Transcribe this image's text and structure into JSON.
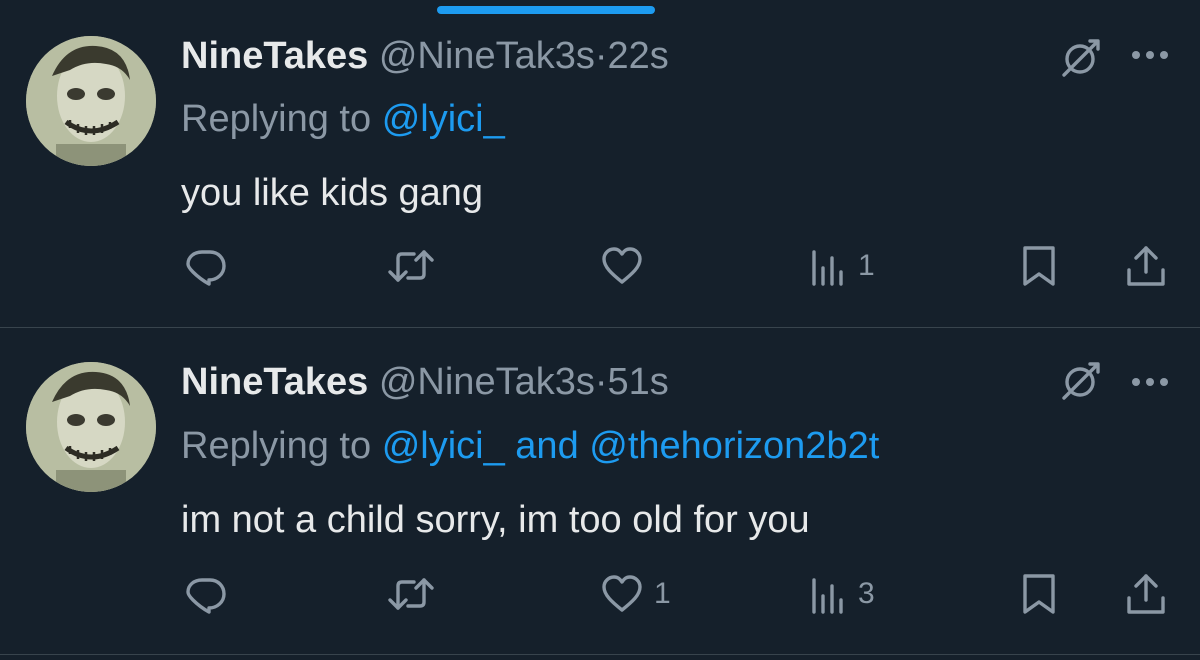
{
  "tweets": [
    {
      "display_name": "NineTakes",
      "handle": "@NineTak3s",
      "separator": "·",
      "time": "22s",
      "replying_prefix": "Replying to",
      "replying_to": "@lyici_",
      "replying_and": "",
      "replying_to_2": "",
      "text": "you like kids gang",
      "reply_count": "",
      "retweet_count": "",
      "like_count": "",
      "view_count": "1"
    },
    {
      "display_name": "NineTakes",
      "handle": "@NineTak3s",
      "separator": "·",
      "time": "51s",
      "replying_prefix": "Replying to",
      "replying_to": "@lyici_",
      "replying_and": "and",
      "replying_to_2": "@thehorizon2b2t",
      "text": "im not a child sorry, im too old for you",
      "reply_count": "",
      "retweet_count": "",
      "like_count": "1",
      "view_count": "3"
    }
  ],
  "icons": {
    "reply": "reply-icon",
    "retweet": "retweet-icon",
    "like": "heart-icon",
    "views": "views-icon",
    "bookmark": "bookmark-icon",
    "share": "share-icon",
    "grok": "grok-icon",
    "more": "more-icon"
  },
  "colors": {
    "background": "#15202b",
    "accent": "#1d9bf0",
    "text_primary": "#e7e9ea",
    "text_secondary": "#8b98a5",
    "divider": "#38444d"
  }
}
